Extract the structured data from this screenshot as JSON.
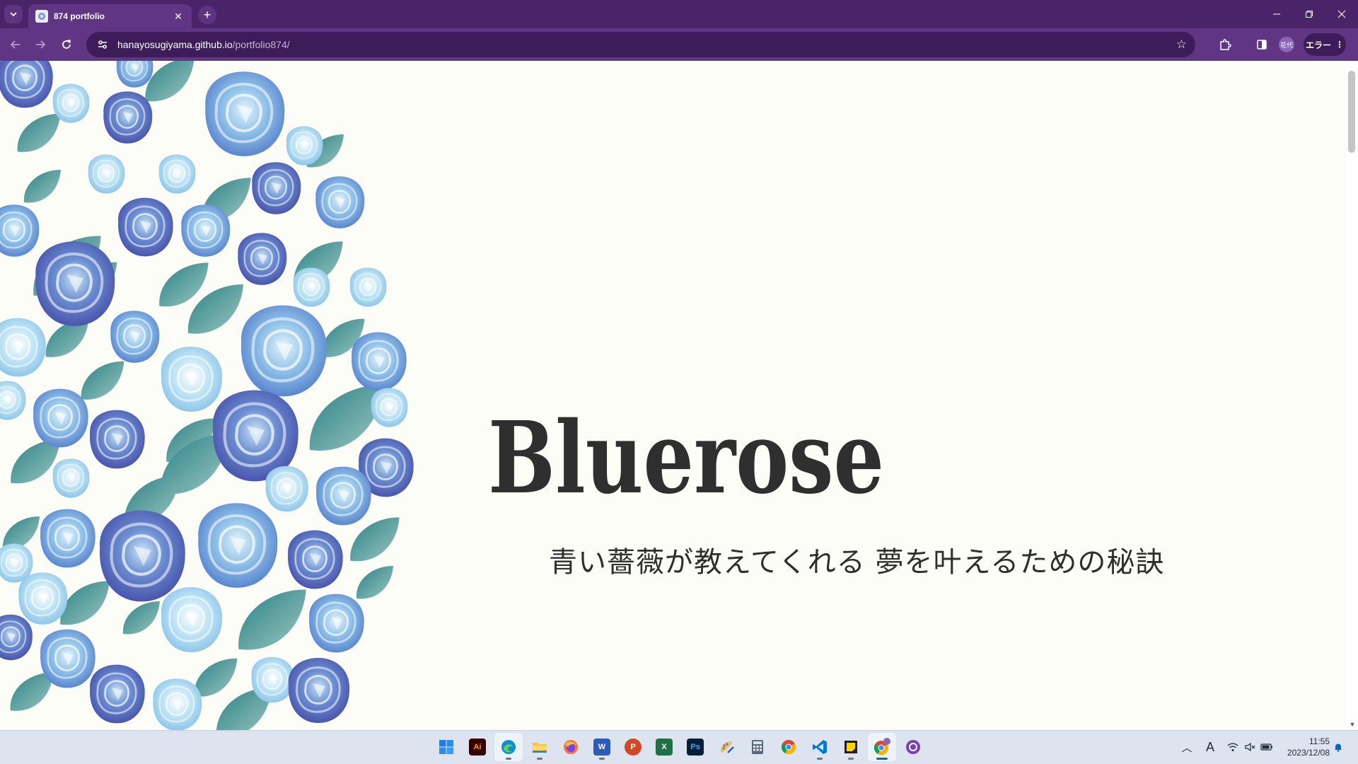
{
  "browser": {
    "tab": {
      "title": "874 portfolio"
    },
    "address": {
      "host": "hanayosugiyama.github.io",
      "path": "/portfolio874/"
    },
    "profile_label": "花代",
    "error_label": "エラー",
    "icons": {
      "tab_menu": "chevron-down-icon",
      "tab_close": "close-icon",
      "new_tab": "plus-icon",
      "back": "arrow-left-icon",
      "forward": "arrow-right-icon",
      "reload": "reload-icon",
      "site_info": "tune-icon",
      "bookmark": "star-icon",
      "extensions": "puzzle-icon",
      "side_panel": "side-panel-icon",
      "menu": "kebab-menu-icon"
    },
    "colors": {
      "frame": "#4a2468",
      "toolbar": "#5f3584",
      "omnibox": "#3e1c59"
    }
  },
  "page": {
    "logo_text": "Bluerose",
    "tagline": "青い薔薇が教えてくれる 夢を叶えるための秘訣",
    "colors": {
      "background": "#fdfdf8",
      "text": "#2f2f2f",
      "rose_dark": "#5a66b8",
      "rose_light": "#9ad2ea",
      "leaf": "#2e8b8a"
    }
  },
  "taskbar": {
    "apps": [
      {
        "name": "start",
        "icon": "windows-start-icon"
      },
      {
        "name": "illustrator",
        "icon": "illustrator-icon",
        "label": "Ai"
      },
      {
        "name": "edge",
        "icon": "edge-browser-icon"
      },
      {
        "name": "file-explorer",
        "icon": "folder-icon"
      },
      {
        "name": "firefox",
        "icon": "firefox-icon"
      },
      {
        "name": "word",
        "icon": "word-icon",
        "label": "W"
      },
      {
        "name": "powerpoint",
        "icon": "powerpoint-icon",
        "label": "P"
      },
      {
        "name": "excel",
        "icon": "excel-icon",
        "label": "X"
      },
      {
        "name": "photoshop",
        "icon": "photoshop-icon",
        "label": "Ps"
      },
      {
        "name": "paint",
        "icon": "paint-icon"
      },
      {
        "name": "calculator",
        "icon": "calculator-icon"
      },
      {
        "name": "chrome",
        "icon": "chrome-icon"
      },
      {
        "name": "vscode",
        "icon": "vscode-icon"
      },
      {
        "name": "sticky-notes",
        "icon": "sticky-notes-icon"
      },
      {
        "name": "chrome-profile",
        "icon": "chrome-profile-icon"
      },
      {
        "name": "github",
        "icon": "github-icon"
      }
    ],
    "tray": {
      "ime_label": "A"
    },
    "clock": {
      "time": "11:55",
      "date": "2023/12/08"
    }
  }
}
